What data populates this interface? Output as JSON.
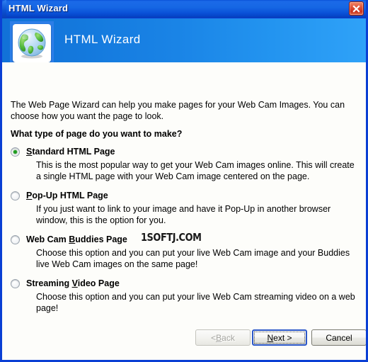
{
  "window": {
    "title": "HTML Wizard",
    "close_icon": "close-icon",
    "accent_titlebar": "#0a52d8",
    "border_color": "#0a3fd4"
  },
  "banner": {
    "title": "HTML Wizard",
    "icon": "globe-icon",
    "gradient_from": "#1272d8",
    "gradient_to": "#2fa2f8"
  },
  "body": {
    "intro": "The Web Page Wizard can help you make pages for your Web Cam Images. You can choose how you want the page to look.",
    "question": "What type of page do you want to make?",
    "options": [
      {
        "label_before": "",
        "accel": "S",
        "label_after": "tandard HTML Page",
        "label_full": "Standard HTML Page",
        "description": "This is the most popular way to get your Web Cam images online. This will create a single HTML page with your Web Cam image centered on the page.",
        "selected": true
      },
      {
        "label_before": "",
        "accel": "P",
        "label_after": "op-Up HTML Page",
        "label_full": "Pop-Up HTML Page",
        "description": "If you just want to link to your image and have it Pop-Up in another browser window, this is the option for you.",
        "selected": false
      },
      {
        "label_before": "Web Cam ",
        "accel": "B",
        "label_after": "uddies Page",
        "label_full": "Web Cam Buddies Page",
        "description": "Choose this option and you can put your live Web Cam image and your Buddies live Web Cam images on the same page!",
        "selected": false
      },
      {
        "label_before": "Streaming ",
        "accel": "V",
        "label_after": "ideo Page",
        "label_full": "Streaming Video Page",
        "description": "Choose this option and you can put your live Web Cam streaming video on a web page!",
        "selected": false
      }
    ]
  },
  "watermark": {
    "text": "1SOFTJ.COM"
  },
  "footer": {
    "back": {
      "before": "< ",
      "accel": "B",
      "after": "ack",
      "full": "< Back",
      "enabled": false
    },
    "next": {
      "before": "",
      "accel": "N",
      "after": "ext >",
      "full": "Next >",
      "default": true
    },
    "cancel": {
      "label": "Cancel"
    }
  }
}
